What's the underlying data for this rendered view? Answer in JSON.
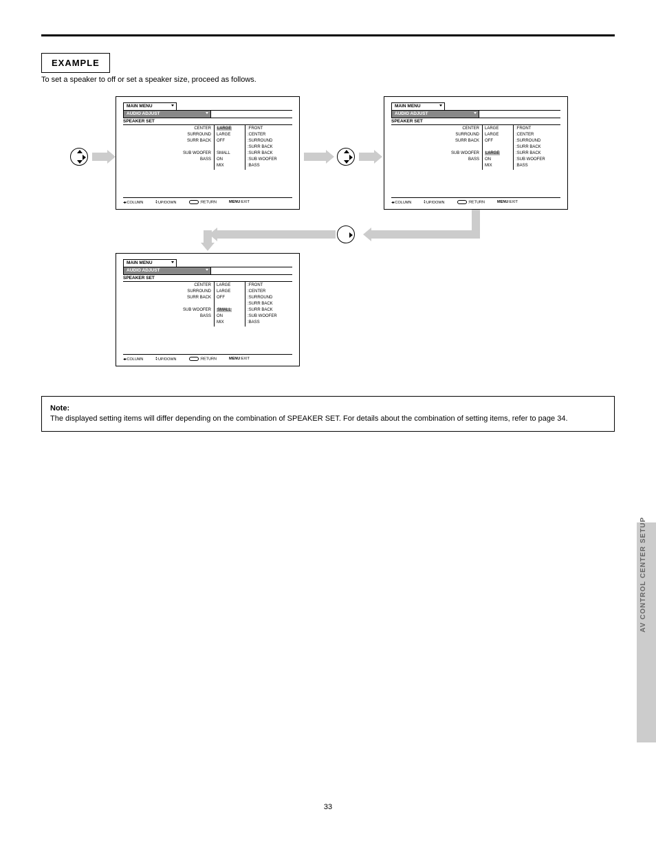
{
  "header": {
    "example_label": "EXAMPLE"
  },
  "instruction_text": "To set a speaker to off or set a speaker size, proceed as follows.",
  "crumbs": {
    "top": "MAIN MENU",
    "second": "AUDIO ADJUST"
  },
  "screens": {
    "header_row": "SPEAKER SET",
    "left_col": [
      "CENTER",
      "SURROUND",
      "SURR BACK",
      "",
      "SUB WOOFER",
      "BASS"
    ],
    "mids": {
      "s1": [
        "LARGE",
        "LARGE",
        "OFF",
        "",
        "SMALL",
        "ON",
        "MIX"
      ],
      "s2": [
        "LARGE",
        "LARGE",
        "OFF",
        "",
        "LARGE",
        "ON",
        "MIX"
      ],
      "s3": [
        "LARGE",
        "LARGE",
        "OFF",
        "",
        "SMALL",
        "ON",
        "MIX"
      ]
    },
    "right_col": [
      "FRONT",
      "CENTER",
      "SURROUND",
      "SURR BACK",
      "SURR BACK",
      "SUB WOOFER",
      "BASS"
    ],
    "highlighted": {
      "s1": 0,
      "s2": 4,
      "s3": 4
    }
  },
  "footer": {
    "col": ":COLUMN",
    "upd": ":UP/DOWN",
    "ret": ":RETURN",
    "exit": ":EXIT"
  },
  "note": {
    "title": "Note:",
    "body": "The displayed setting items will differ depending on the combination of SPEAKER SET. For details about the combination of setting items, refer to page 34."
  },
  "side_tab": "AV CONTROL CENTER SETUP",
  "page_number": "33"
}
